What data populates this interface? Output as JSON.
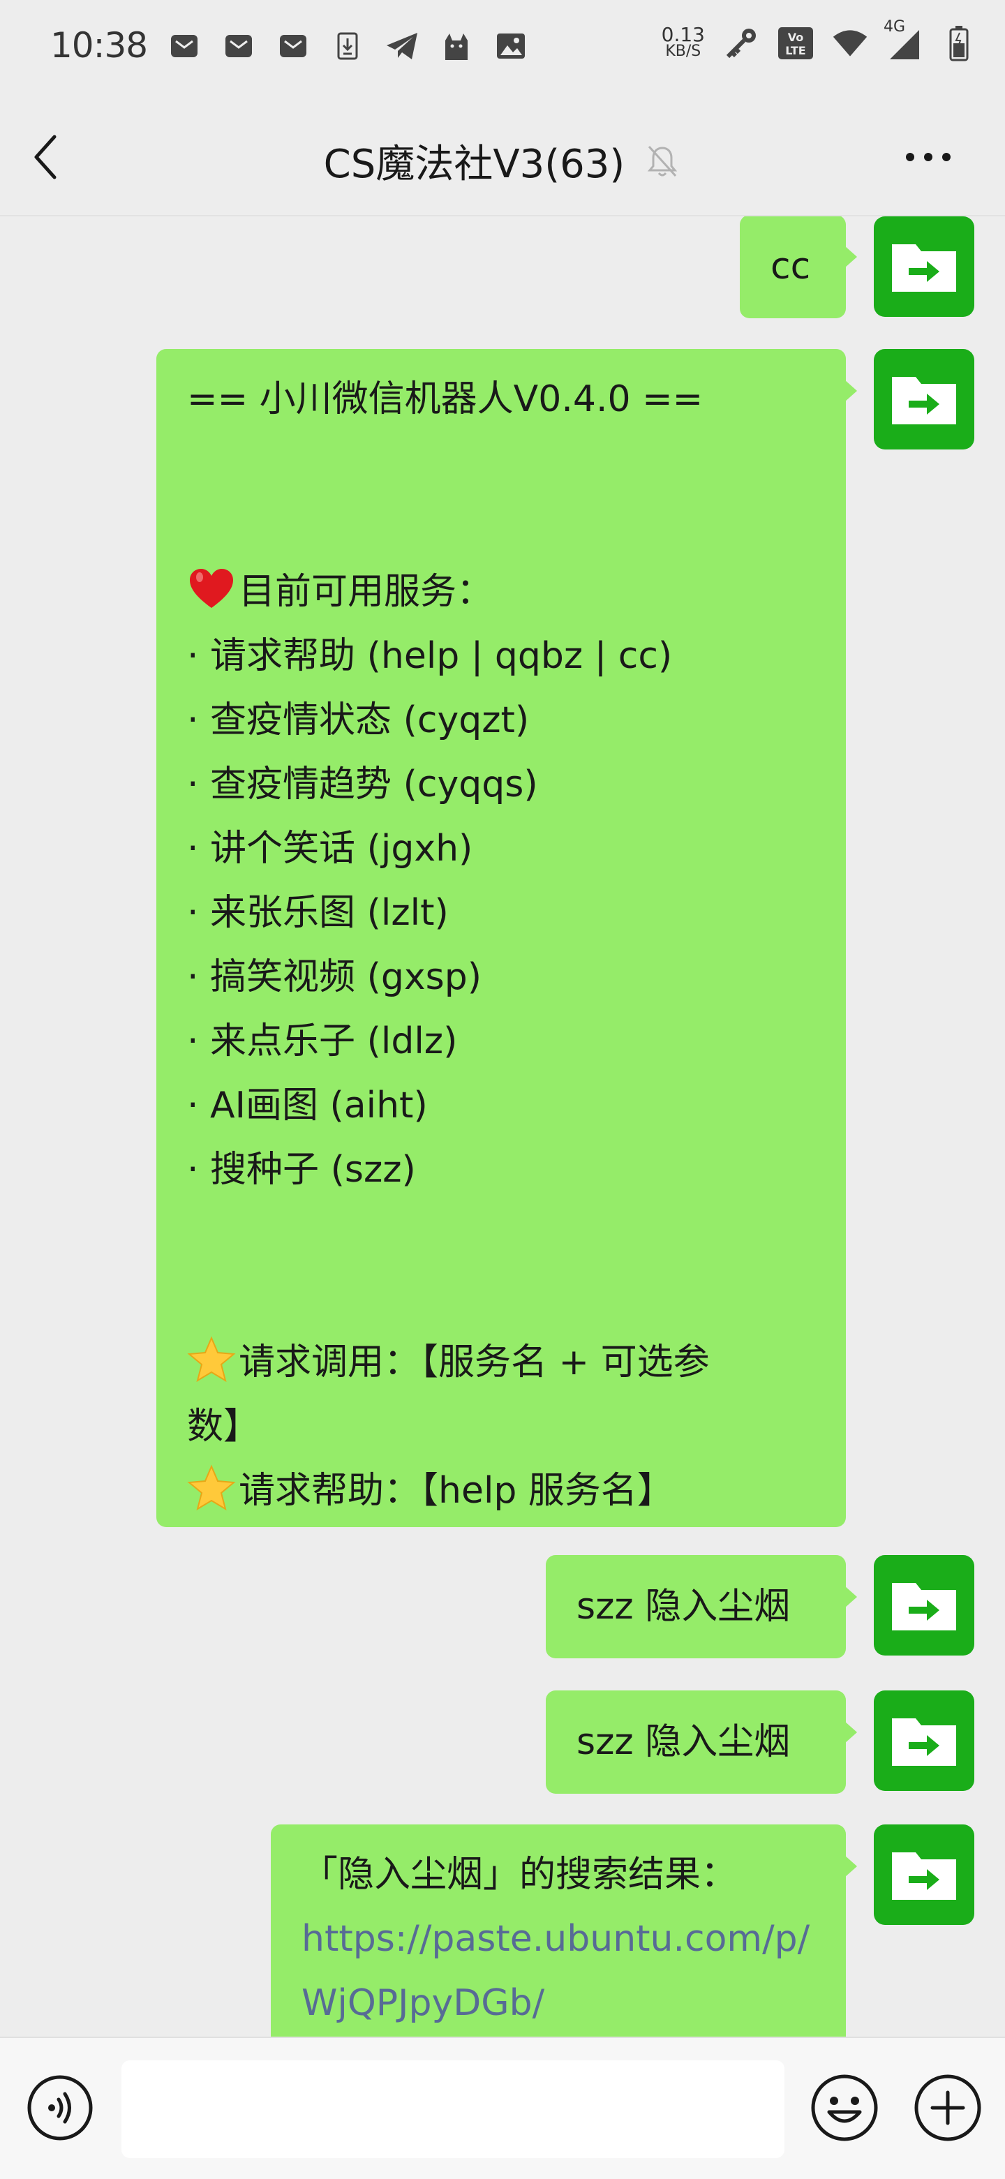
{
  "status_bar": {
    "time": "10:38",
    "net_speed_value": "0.13",
    "net_speed_unit": "KB/S",
    "network": "4G",
    "icons": [
      "mail-icon",
      "mail-icon",
      "mail-icon",
      "download-icon",
      "telegram-icon",
      "cat-icon",
      "image-icon",
      "key-icon",
      "volte-icon",
      "wifi-icon",
      "signal-icon",
      "battery-icon"
    ]
  },
  "header": {
    "title": "CS魔法社V3(63)",
    "icons": [
      "back-arrow-icon",
      "mute-bell-icon",
      "more-dots-icon"
    ]
  },
  "messages": [
    {
      "side": "right",
      "lines": [
        "cc"
      ]
    },
    {
      "side": "right",
      "lines": [
        "== 小川微信机器人V0.4.0 ==",
        "",
        "",
        "目前可用服务：",
        "· 请求帮助 (help | qqbz | cc)",
        "· 查疫情状态 (cyqzt)",
        "· 查疫情趋势 (cyqqs)",
        "· 讲个笑话 (jgxh)",
        "· 来张乐图 (lzlt)",
        "· 搞笑视频 (gxsp)",
        "· 来点乐子 (ldlz)",
        "· AI画图 (aiht)",
        "· 搜种子 (szz)",
        "",
        "",
        "请求调用：【服务名 + 可选参",
        "数】",
        "请求帮助：【help 服务名】"
      ]
    },
    {
      "side": "right",
      "lines": [
        "szz 隐入尘烟"
      ]
    },
    {
      "side": "right",
      "lines": [
        "szz 隐入尘烟"
      ]
    },
    {
      "side": "right",
      "lines": [
        "「隐入尘烟」的搜索结果："
      ],
      "link_lines": [
        "https://paste.ubuntu.com/p/",
        "WjQPJpyDGb/"
      ]
    }
  ],
  "avatar_icon": "folder-arrow-icon",
  "colors": {
    "bubble": "#95ec69",
    "avatar": "#1aad19",
    "link": "#576b95",
    "background": "#ededed"
  },
  "input_bar": {
    "icons": [
      "voice-icon",
      "emoji-icon",
      "plus-icon"
    ]
  }
}
